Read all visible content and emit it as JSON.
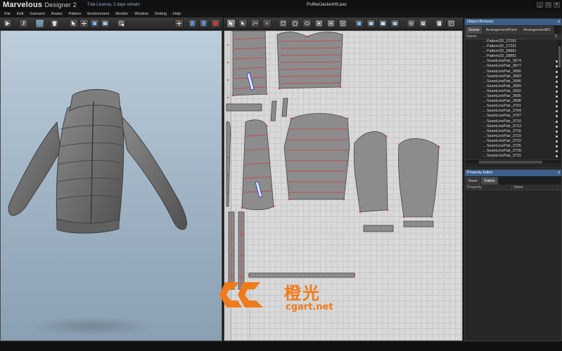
{
  "app": {
    "title_main": "Marvelous",
    "title_sub": "Designer 2",
    "license": "Trial License, 2 days remain",
    "filename": "PuffedJacket08.pac"
  },
  "menu": [
    "File",
    "Edit",
    "Garment",
    "Avatar",
    "Pattern",
    "Environment",
    "Render",
    "Window",
    "Setting",
    "Help"
  ],
  "window_controls": [
    "_",
    "□",
    "×"
  ],
  "object_browser": {
    "title": "Object Browser",
    "close": "x",
    "tabs": [
      "Scene",
      "ArrangementPoint",
      "ArrangementBV"
    ],
    "active_tab": "Scene",
    "col_name": "Name",
    "col_s": "S",
    "items": [
      "Pattern2D_27291",
      "Pattern2D_27291",
      "Pattern2D_28881",
      "Pattern2D_28881",
      "SeamLinePair_3674",
      "SeamLinePair_3677",
      "SeamLinePair_3680",
      "SeamLinePair_3683",
      "SeamLinePair_3686",
      "SeamLinePair_3689",
      "SeamLinePair_3692",
      "SeamLinePair_3695",
      "SeamLinePair_3698",
      "SeamLinePair_3701",
      "SeamLinePair_3704",
      "SeamLinePair_3707",
      "SeamLinePair_3710",
      "SeamLinePair_3713",
      "SeamLinePair_3716",
      "SeamLinePair_3719",
      "SeamLinePair_3722",
      "SeamLinePair_3725",
      "SeamLinePair_3728",
      "SeamLinePair_3731"
    ]
  },
  "property_editor": {
    "title": "Property Editor",
    "close": "x",
    "tabs": [
      "Basic",
      "Fabric"
    ],
    "active_tab": "Fabric",
    "col_property": "Property",
    "col_value": "Value"
  },
  "watermark": {
    "cn": "橙光",
    "en": "cgart.net",
    "color": "#f07a1a"
  },
  "colors": {
    "panel_header": "#3c5f8a",
    "pattern_fill": "#8c8c8c",
    "seam_line": "#d23a3a",
    "viewport_sky": "#b4c6d6"
  }
}
